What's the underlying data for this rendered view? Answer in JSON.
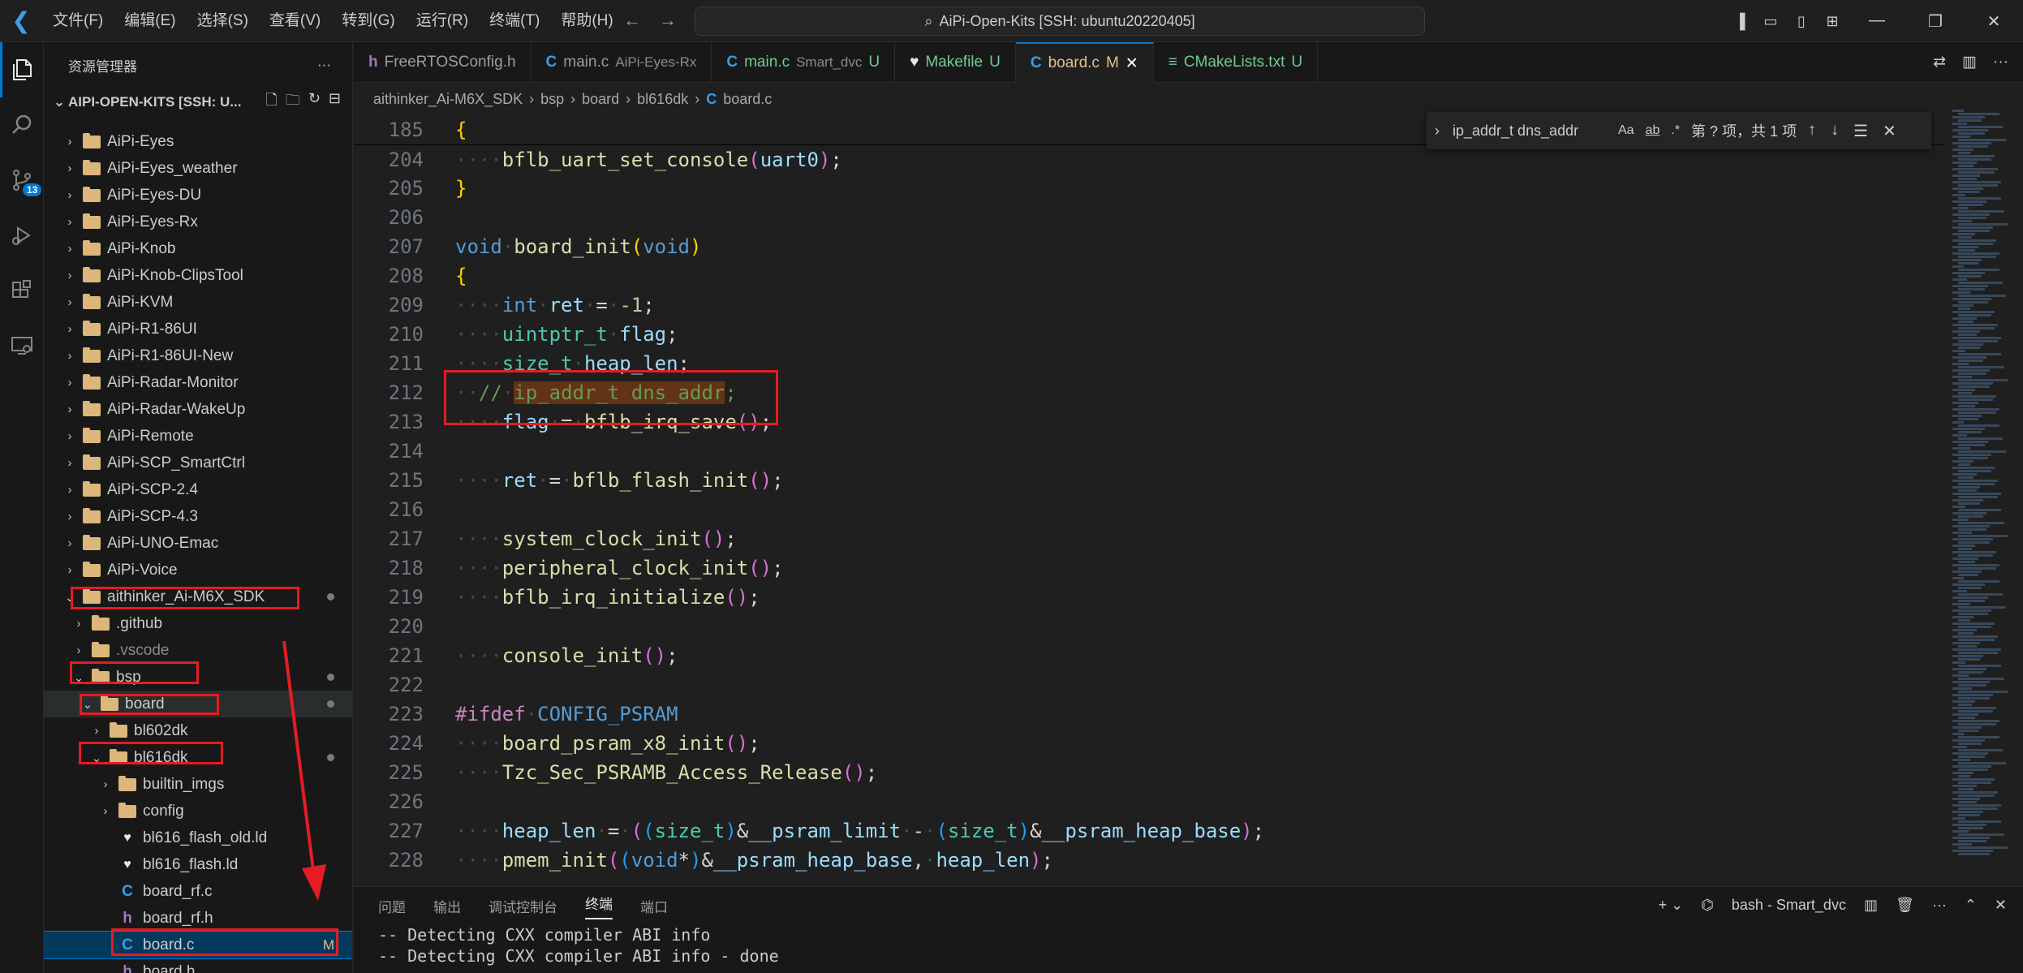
{
  "menu": [
    "文件(F)",
    "编辑(E)",
    "选择(S)",
    "查看(V)",
    "转到(G)",
    "运行(R)",
    "终端(T)",
    "帮助(H)"
  ],
  "command_center": "AiPi-Open-Kits [SSH: ubuntu20220405]",
  "activity_badge": "13",
  "sidebar": {
    "title": "资源管理器",
    "section": "AIPI-OPEN-KITS [SSH: U...",
    "items": [
      {
        "label": "AiPi-Eyes",
        "indent": 0,
        "type": "folder",
        "chev": "›"
      },
      {
        "label": "AiPi-Eyes_weather",
        "indent": 0,
        "type": "folder",
        "chev": "›"
      },
      {
        "label": "AiPi-Eyes-DU",
        "indent": 0,
        "type": "folder",
        "chev": "›"
      },
      {
        "label": "AiPi-Eyes-Rx",
        "indent": 0,
        "type": "folder",
        "chev": "›"
      },
      {
        "label": "AiPi-Knob",
        "indent": 0,
        "type": "folder",
        "chev": "›"
      },
      {
        "label": "AiPi-Knob-ClipsTool",
        "indent": 0,
        "type": "folder",
        "chev": "›"
      },
      {
        "label": "AiPi-KVM",
        "indent": 0,
        "type": "folder",
        "chev": "›"
      },
      {
        "label": "AiPi-R1-86UI",
        "indent": 0,
        "type": "folder",
        "chev": "›"
      },
      {
        "label": "AiPi-R1-86UI-New",
        "indent": 0,
        "type": "folder",
        "chev": "›"
      },
      {
        "label": "AiPi-Radar-Monitor",
        "indent": 0,
        "type": "folder",
        "chev": "›"
      },
      {
        "label": "AiPi-Radar-WakeUp",
        "indent": 0,
        "type": "folder",
        "chev": "›"
      },
      {
        "label": "AiPi-Remote",
        "indent": 0,
        "type": "folder",
        "chev": "›"
      },
      {
        "label": "AiPi-SCP_SmartCtrl",
        "indent": 0,
        "type": "folder",
        "chev": "›"
      },
      {
        "label": "AiPi-SCP-2.4",
        "indent": 0,
        "type": "folder",
        "chev": "›"
      },
      {
        "label": "AiPi-SCP-4.3",
        "indent": 0,
        "type": "folder",
        "chev": "›"
      },
      {
        "label": "AiPi-UNO-Emac",
        "indent": 0,
        "type": "folder",
        "chev": "›"
      },
      {
        "label": "AiPi-Voice",
        "indent": 0,
        "type": "folder",
        "chev": "›"
      },
      {
        "label": "aithinker_Ai-M6X_SDK",
        "indent": 0,
        "type": "folder",
        "chev": "⌄",
        "dot": true
      },
      {
        "label": ".github",
        "indent": 1,
        "type": "folder",
        "chev": "›"
      },
      {
        "label": ".vscode",
        "indent": 1,
        "type": "folder",
        "chev": "›",
        "dim": true
      },
      {
        "label": "bsp",
        "indent": 1,
        "type": "folder",
        "chev": "⌄",
        "dot": true
      },
      {
        "label": "board",
        "indent": 2,
        "type": "folder",
        "chev": "⌄",
        "dot": true,
        "hover": true
      },
      {
        "label": "bl602dk",
        "indent": 3,
        "type": "folder",
        "chev": "›"
      },
      {
        "label": "bl616dk",
        "indent": 3,
        "type": "folder",
        "chev": "⌄",
        "dot": true
      },
      {
        "label": "builtin_imgs",
        "indent": 4,
        "type": "folder",
        "chev": "›"
      },
      {
        "label": "config",
        "indent": 4,
        "type": "folder",
        "chev": "›"
      },
      {
        "label": "bl616_flash_old.ld",
        "indent": 4,
        "type": "ld",
        "chev": ""
      },
      {
        "label": "bl616_flash.ld",
        "indent": 4,
        "type": "ld",
        "chev": ""
      },
      {
        "label": "board_rf.c",
        "indent": 4,
        "type": "c",
        "chev": ""
      },
      {
        "label": "board_rf.h",
        "indent": 4,
        "type": "h",
        "chev": ""
      },
      {
        "label": "board.c",
        "indent": 4,
        "type": "c",
        "chev": "",
        "selected": true,
        "mod": "M"
      },
      {
        "label": "board.h",
        "indent": 4,
        "type": "h",
        "chev": ""
      }
    ]
  },
  "tabs": [
    {
      "icon": "h",
      "name": "FreeRTOSConfig.h",
      "desc": "",
      "status": ""
    },
    {
      "icon": "C",
      "name": "main.c",
      "desc": "AiPi-Eyes-Rx",
      "status": ""
    },
    {
      "icon": "C",
      "name": "main.c",
      "desc": "Smart_dvc",
      "status": "U"
    },
    {
      "icon": "♥",
      "name": "Makefile",
      "desc": "",
      "status": "U"
    },
    {
      "icon": "C",
      "name": "board.c",
      "desc": "",
      "status": "M",
      "active": true
    },
    {
      "icon": "≡",
      "name": "CMakeLists.txt",
      "desc": "",
      "status": "U"
    }
  ],
  "breadcrumbs": [
    "aithinker_Ai-M6X_SDK",
    "bsp",
    "board",
    "bl616dk",
    "board.c"
  ],
  "find": {
    "query": "ip_addr_t dns_addr",
    "result": "第 ? 项，共 1 项",
    "opt_case": "Aa",
    "opt_word": "ab",
    "opt_regex": ".*"
  },
  "code": [
    {
      "n": "185",
      "html": "<span class='br1'>{</span>"
    },
    {
      "n": "204",
      "html": "<span class='ws'>····</span><span class='fn'>bflb_uart_set_console</span><span class='br2'>(</span><span class='var'>uart0</span><span class='br2'>)</span>;"
    },
    {
      "n": "205",
      "html": "<span class='br1'>}</span>"
    },
    {
      "n": "206",
      "html": ""
    },
    {
      "n": "207",
      "html": "<span class='kw'>void</span><span class='ws'>·</span><span class='fn'>board_init</span><span class='br1'>(</span><span class='kw'>void</span><span class='br1'>)</span>"
    },
    {
      "n": "208",
      "html": "<span class='br1'>{</span>"
    },
    {
      "n": "209",
      "html": "<span class='ws'>····</span><span class='kw'>int</span><span class='ws'>·</span><span class='var'>ret</span><span class='ws'>·</span>=<span class='ws'>·</span><span class='nu'>-1</span>;"
    },
    {
      "n": "210",
      "html": "<span class='ws'>····</span><span class='ty'>uintptr_t</span><span class='ws'>·</span><span class='var'>flag</span>;"
    },
    {
      "n": "211",
      "html": "<span class='ws'>····</span><span class='ty'>size_t</span><span class='ws'>·</span><span class='var'>heap_len</span>;"
    },
    {
      "n": "212",
      "html": "<span class='ws'>··</span><span class='cm'>//<span class='ws'>·</span><span class='hl'>ip_addr_t<span class='ws'>·</span>dns_addr</span>;</span>"
    },
    {
      "n": "213",
      "html": "<span class='ws'>····</span><span class='var'>flag</span><span class='ws'>·</span>=<span class='ws'>·</span><span class='fn'>bflb_irq_save</span><span class='br2'>()</span>;"
    },
    {
      "n": "214",
      "html": ""
    },
    {
      "n": "215",
      "html": "<span class='ws'>····</span><span class='var'>ret</span><span class='ws'>·</span>=<span class='ws'>·</span><span class='fn'>bflb_flash_init</span><span class='br2'>()</span>;"
    },
    {
      "n": "216",
      "html": ""
    },
    {
      "n": "217",
      "html": "<span class='ws'>····</span><span class='fn'>system_clock_init</span><span class='br2'>()</span>;"
    },
    {
      "n": "218",
      "html": "<span class='ws'>····</span><span class='fn'>peripheral_clock_init</span><span class='br2'>()</span>;"
    },
    {
      "n": "219",
      "html": "<span class='ws'>····</span><span class='fn'>bflb_irq_initialize</span><span class='br2'>()</span>;"
    },
    {
      "n": "220",
      "html": ""
    },
    {
      "n": "221",
      "html": "<span class='ws'>····</span><span class='fn'>console_init</span><span class='br2'>()</span>;"
    },
    {
      "n": "222",
      "html": ""
    },
    {
      "n": "223",
      "html": "<span class='pp'>#ifdef</span><span class='ws'>·</span><span class='kw'>CONFIG_PSRAM</span>"
    },
    {
      "n": "224",
      "html": "<span class='ws'>····</span><span class='fn'>board_psram_x8_init</span><span class='br2'>()</span>;"
    },
    {
      "n": "225",
      "html": "<span class='ws'>····</span><span class='fn'>Tzc_Sec_PSRAMB_Access_Release</span><span class='br2'>()</span>;"
    },
    {
      "n": "226",
      "html": ""
    },
    {
      "n": "227",
      "html": "<span class='ws'>····</span><span class='var'>heap_len</span><span class='ws'>·</span>=<span class='ws'>·</span><span class='br2'>(</span><span class='br3'>(</span><span class='ty'>size_t</span><span class='br3'>)</span>&amp;<span class='var'>__psram_limit</span><span class='ws'>·</span>-<span class='ws'>·</span><span class='br3'>(</span><span class='ty'>size_t</span><span class='br3'>)</span>&amp;<span class='var'>__psram_heap_base</span><span class='br2'>)</span>;"
    },
    {
      "n": "228",
      "html": "<span class='ws'>····</span><span class='fn'>pmem_init</span><span class='br2'>(</span><span class='br3'>(</span><span class='kw'>void</span>*<span class='br3'>)</span>&amp;<span class='var'>__psram_heap_base</span>,<span class='ws'>·</span><span class='var'>heap_len</span><span class='br2'>)</span>;"
    }
  ],
  "panel": {
    "tabs": [
      "问题",
      "输出",
      "调试控制台",
      "终端",
      "端口"
    ],
    "active_tab": "终端",
    "terminal_name": "bash - Smart_dvc",
    "terminal_lines": [
      "-- Detecting CXX compiler ABI info",
      "-- Detecting CXX compiler ABI info - done"
    ]
  }
}
